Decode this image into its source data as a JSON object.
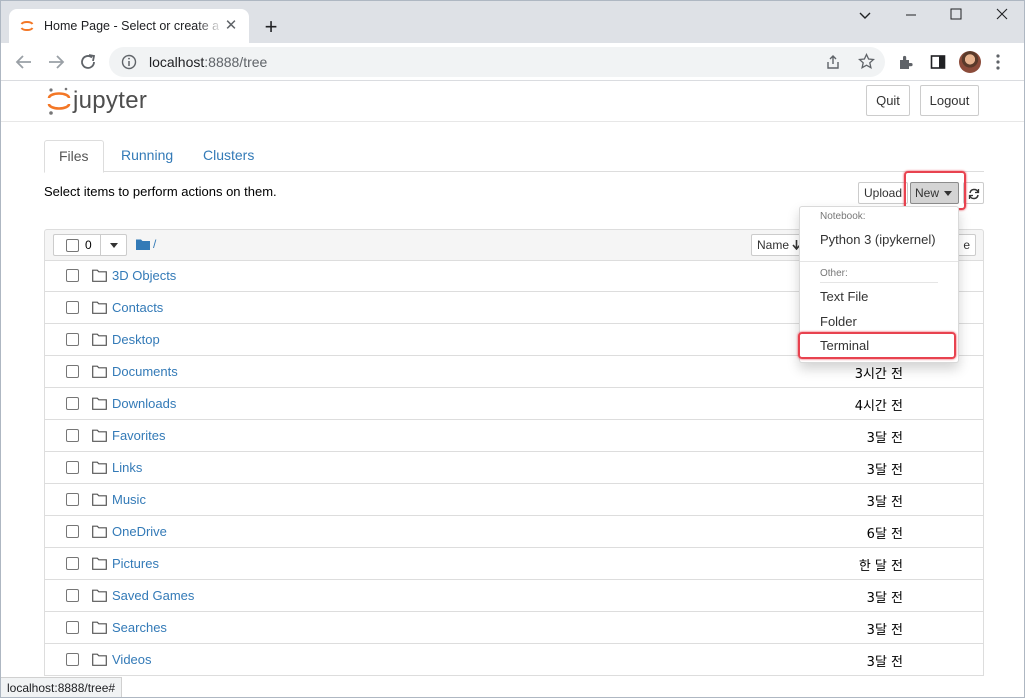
{
  "browser": {
    "tab_title": "Home Page - Select or create a notebook",
    "url_host": "localhost",
    "url_rest": ":8888/tree",
    "status_url": "localhost:8888/tree#"
  },
  "jupyter": {
    "logo_text": "jupyter",
    "quit_label": "Quit",
    "logout_label": "Logout",
    "tabs": [
      {
        "label": "Files",
        "active": true
      },
      {
        "label": "Running",
        "active": false
      },
      {
        "label": "Clusters",
        "active": false
      }
    ],
    "hint": "Select items to perform actions on them.",
    "upload_label": "Upload",
    "new_label": "New",
    "selected_count": "0",
    "breadcrumb": "/",
    "name_sort_label": "Name",
    "hidden_column_tail": "e"
  },
  "new_menu": {
    "notebook_header": "Notebook:",
    "python_kernel": "Python 3 (ipykernel)",
    "other_header": "Other:",
    "text_file": "Text File",
    "folder": "Folder",
    "terminal": "Terminal"
  },
  "files": [
    {
      "name": "3D Objects",
      "modified": ""
    },
    {
      "name": "Contacts",
      "modified": ""
    },
    {
      "name": "Desktop",
      "modified": ""
    },
    {
      "name": "Documents",
      "modified": "3시간 전"
    },
    {
      "name": "Downloads",
      "modified": "4시간 전"
    },
    {
      "name": "Favorites",
      "modified": "3달 전"
    },
    {
      "name": "Links",
      "modified": "3달 전"
    },
    {
      "name": "Music",
      "modified": "3달 전"
    },
    {
      "name": "OneDrive",
      "modified": "6달 전"
    },
    {
      "name": "Pictures",
      "modified": "한 달 전"
    },
    {
      "name": "Saved Games",
      "modified": "3달 전"
    },
    {
      "name": "Searches",
      "modified": "3달 전"
    },
    {
      "name": "Videos",
      "modified": "3달 전"
    }
  ],
  "colors": {
    "link": "#337ab7",
    "highlight": "#e8424f",
    "jupyter_orange": "#f37726"
  }
}
